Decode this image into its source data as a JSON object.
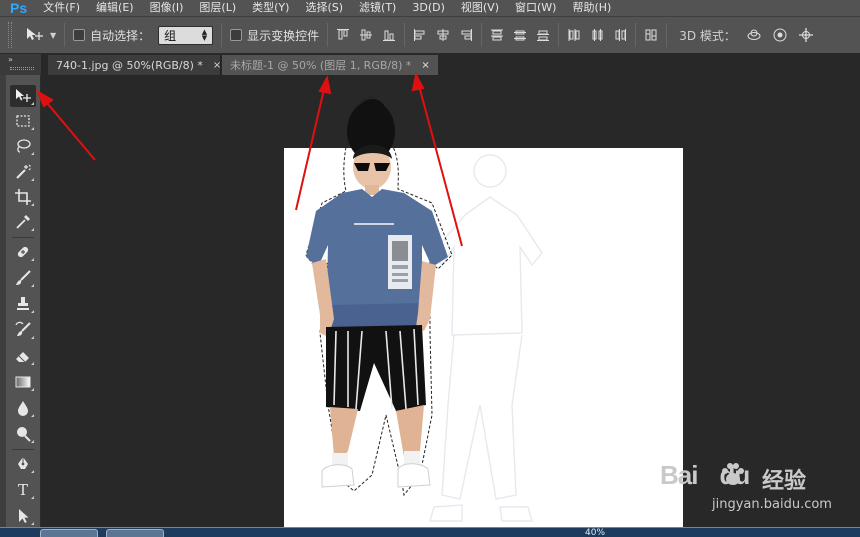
{
  "app": {
    "logo": "Ps",
    "accent_color": "#31a8ff"
  },
  "menu": {
    "items": [
      {
        "label": "文件(F)"
      },
      {
        "label": "编辑(E)"
      },
      {
        "label": "图像(I)"
      },
      {
        "label": "图层(L)"
      },
      {
        "label": "类型(Y)"
      },
      {
        "label": "选择(S)"
      },
      {
        "label": "滤镜(T)"
      },
      {
        "label": "3D(D)"
      },
      {
        "label": "视图(V)"
      },
      {
        "label": "窗口(W)"
      },
      {
        "label": "帮助(H)"
      }
    ]
  },
  "options_bar": {
    "tool_icon": "move-tool-icon",
    "auto_select_label": "自动选择：",
    "auto_select_checked": false,
    "auto_select_value": "组",
    "show_transform_label": "显示变换控件",
    "show_transform_checked": false,
    "mode_label": "3D 模式：",
    "align_icons": [
      "align-top-icon",
      "align-vcenter-icon",
      "align-bottom-icon",
      "align-left-icon",
      "align-hcenter-icon",
      "align-right-icon"
    ],
    "distribute_icons": [
      "distribute-top-icon",
      "distribute-vcenter-icon",
      "distribute-bottom-icon",
      "distribute-left-icon",
      "distribute-hcenter-icon",
      "distribute-right-icon",
      "auto-align-icon"
    ],
    "mode_icons": [
      "orbit-3d-icon",
      "roll-3d-icon",
      "pan-3d-icon"
    ]
  },
  "tabs": [
    {
      "label": "740-1.jpg @ 50%(RGB/8) *",
      "close": "×",
      "active": false
    },
    {
      "label": "未标题-1 @ 50% (图层 1, RGB/8) *",
      "close": "×",
      "active": true
    }
  ],
  "toolbox": {
    "collapse_glyph": "»",
    "tools": [
      {
        "name": "move-tool-icon",
        "active": true
      },
      {
        "name": "marquee-tool-icon"
      },
      {
        "name": "lasso-tool-icon"
      },
      {
        "name": "magic-wand-tool-icon"
      },
      {
        "name": "crop-tool-icon"
      },
      {
        "name": "eyedropper-tool-icon"
      },
      {
        "name": "healing-brush-tool-icon"
      },
      {
        "name": "brush-tool-icon"
      },
      {
        "name": "clone-stamp-tool-icon"
      },
      {
        "name": "history-brush-tool-icon"
      },
      {
        "name": "eraser-tool-icon"
      },
      {
        "name": "gradient-tool-icon"
      },
      {
        "name": "blur-tool-icon"
      },
      {
        "name": "dodge-tool-icon"
      },
      {
        "name": "pen-tool-icon"
      },
      {
        "name": "type-tool-icon",
        "label": "T"
      },
      {
        "name": "path-selection-tool-icon"
      }
    ]
  },
  "canvas": {
    "background": "#ffffff",
    "annotation_color": "#e01010"
  },
  "watermark": {
    "brand": "Bai",
    "brand_suffix": "du",
    "cn_text": "经验",
    "url": "jingyan.baidu.com"
  },
  "taskbar": {
    "tray_text": "40%"
  }
}
